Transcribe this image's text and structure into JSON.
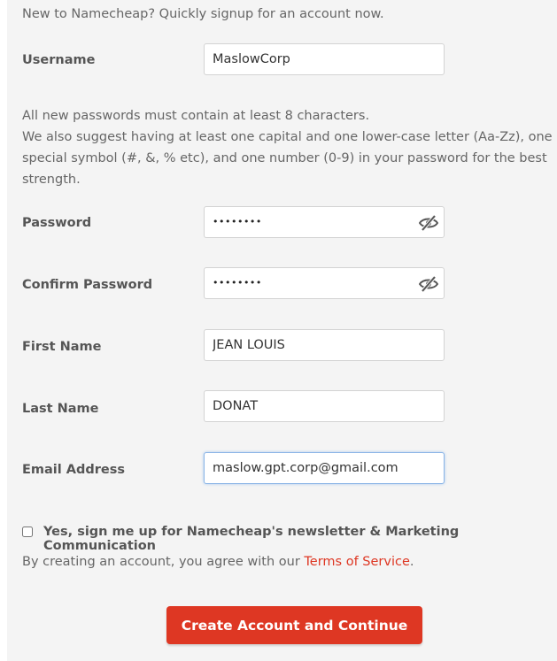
{
  "intro_text": "New to Namecheap? Quickly signup for an account now.",
  "username": {
    "label": "Username",
    "value": "MaslowCorp"
  },
  "password_hint": {
    "line1": "All new passwords must contain at least 8 characters.",
    "line2": "We also suggest having at least one capital and one lower-case letter (Aa-Zz), one special symbol (#, &, % etc), and one number (0-9) in your password for the best strength."
  },
  "password": {
    "label": "Password",
    "masked": "••••••••"
  },
  "confirm_password": {
    "label": "Confirm Password",
    "masked": "••••••••"
  },
  "first_name": {
    "label": "First Name",
    "value": "JEAN LOUIS"
  },
  "last_name": {
    "label": "Last Name",
    "value": "DONAT"
  },
  "email": {
    "label": "Email Address",
    "value": "maslow.gpt.corp@gmail.com"
  },
  "newsletter": {
    "label": "Yes, sign me up for Namecheap's newsletter & Marketing Communication",
    "checked": false
  },
  "terms": {
    "prefix": "By creating an account, you agree with our ",
    "link": "Terms of Service",
    "suffix": "."
  },
  "submit_label": "Create Account and Continue",
  "icons": {
    "toggle_visibility": "eye-slash-icon"
  },
  "colors": {
    "accent": "#de3723",
    "panel_bg": "#f4f4f4",
    "focus_border": "#8ab4e6"
  }
}
